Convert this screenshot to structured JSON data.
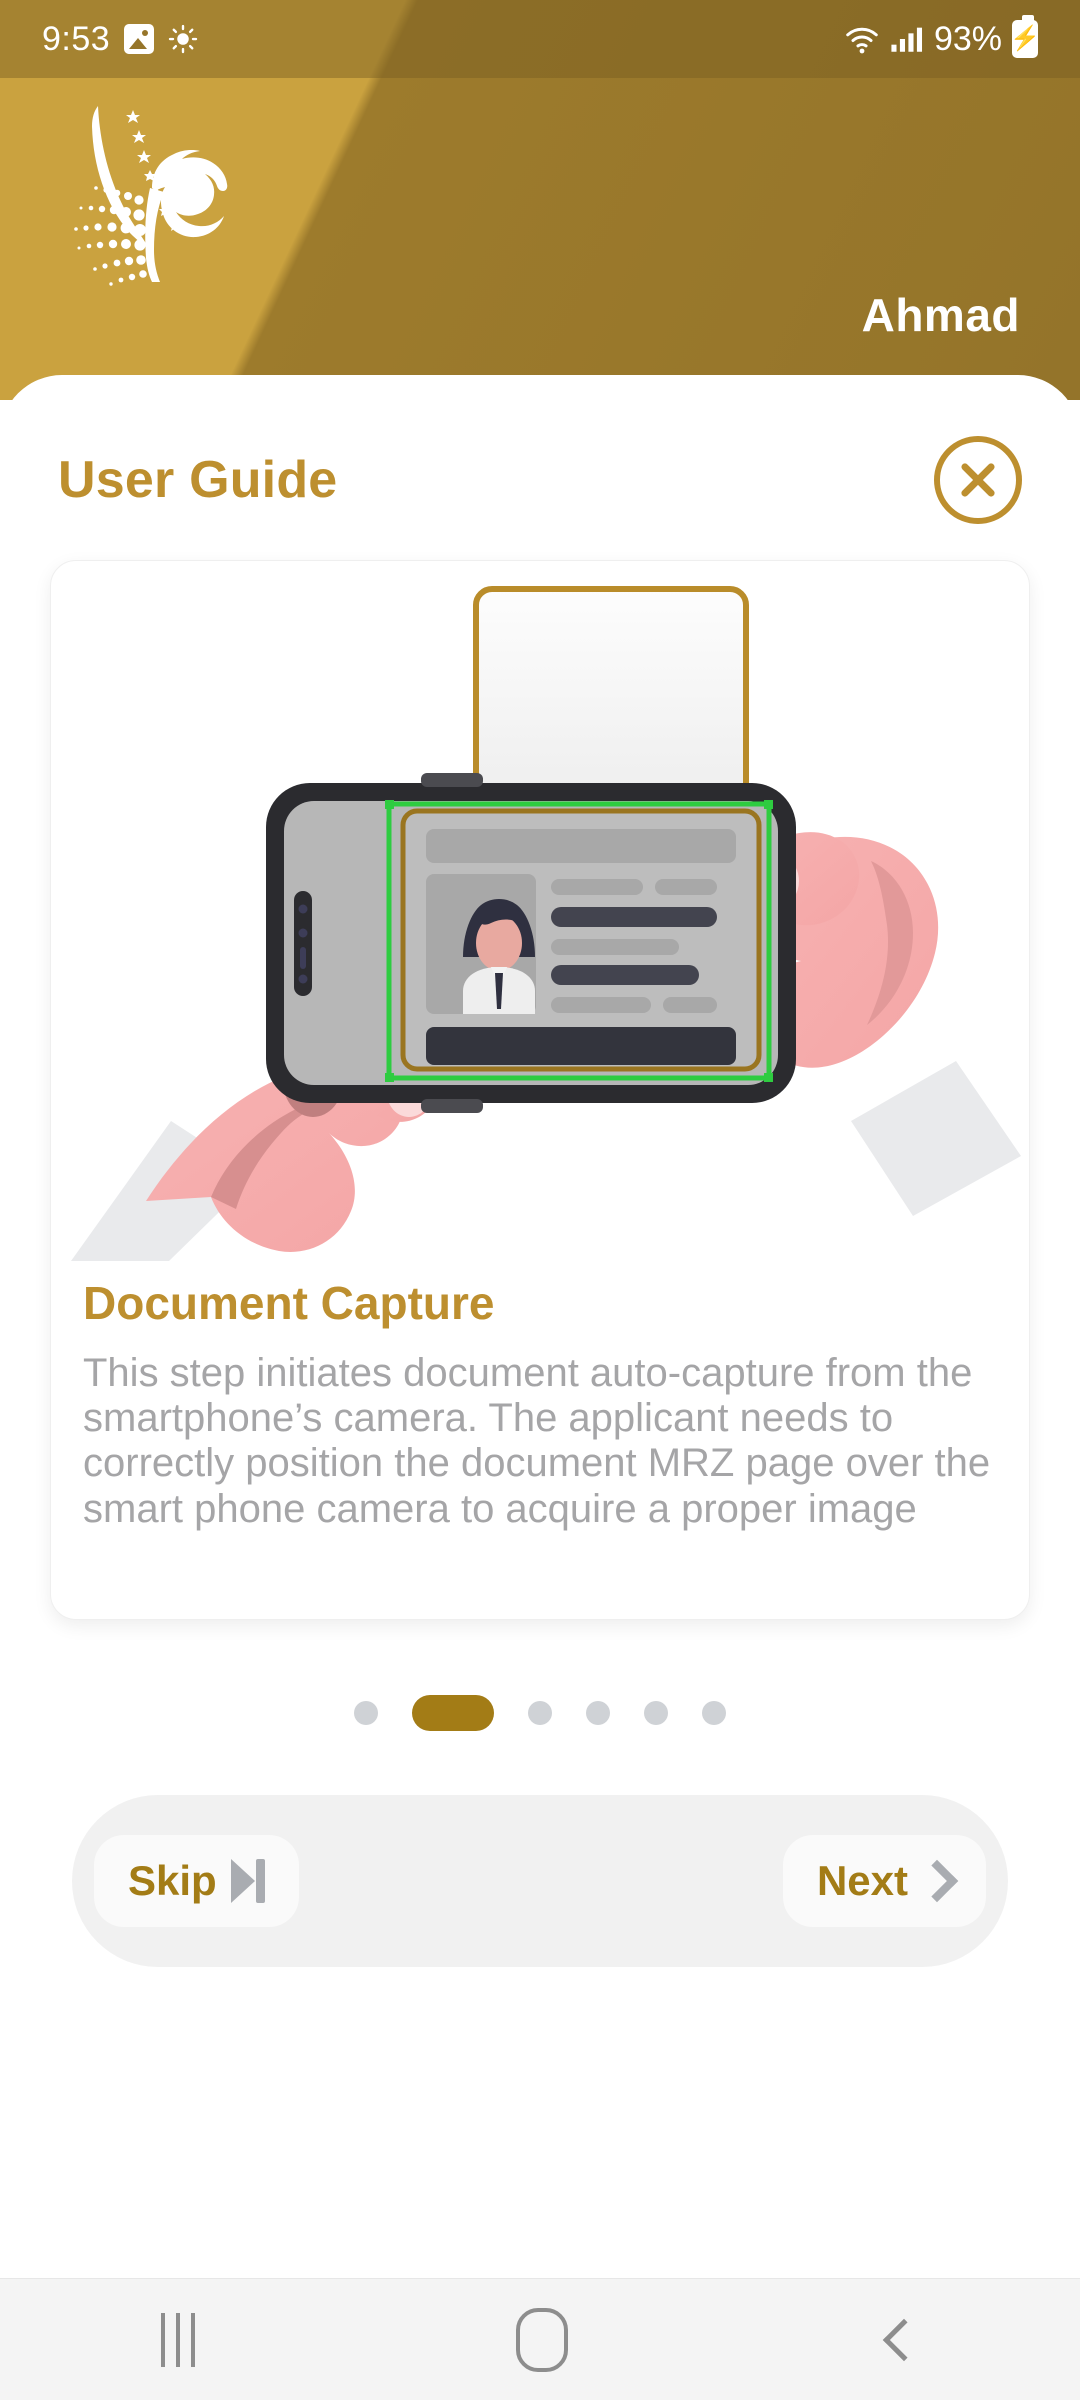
{
  "statusbar": {
    "time": "9:53",
    "battery_percent": "93%",
    "icons": [
      "gallery-icon",
      "brightness-icon",
      "wifi-icon",
      "signal-icon",
      "battery-charging-icon"
    ]
  },
  "header": {
    "logo_name": "falcon-logo",
    "user_name": "Ahmad",
    "background_color": "#96752a",
    "accent_color": "#caa23f"
  },
  "sheet": {
    "title": "User Guide",
    "close_label": "close-icon"
  },
  "card": {
    "illustration_name": "document-capture-illustration",
    "title": "Document Capture",
    "body": "This step initiates document auto-capture from the smartphone’s camera. The applicant needs to correctly position the document MRZ page over the smart phone camera to acquire a proper image"
  },
  "pagination": {
    "total": 6,
    "active_index": 1,
    "active_color": "#a37c16",
    "inactive_color": "#cfd2d6"
  },
  "footer": {
    "skip_label": "Skip",
    "next_label": "Next",
    "skip_icon": "skip-forward-icon",
    "next_icon": "chevron-right-icon",
    "accent_color": "#a37c16"
  },
  "androidnav": {
    "recents_label": "recents-icon",
    "home_label": "home-icon",
    "back_label": "back-icon"
  },
  "colors": {
    "gold": "#bd8f2f",
    "gold_dark": "#a37c16",
    "header_gold": "#96752a",
    "body_text": "#a5a5a7"
  }
}
